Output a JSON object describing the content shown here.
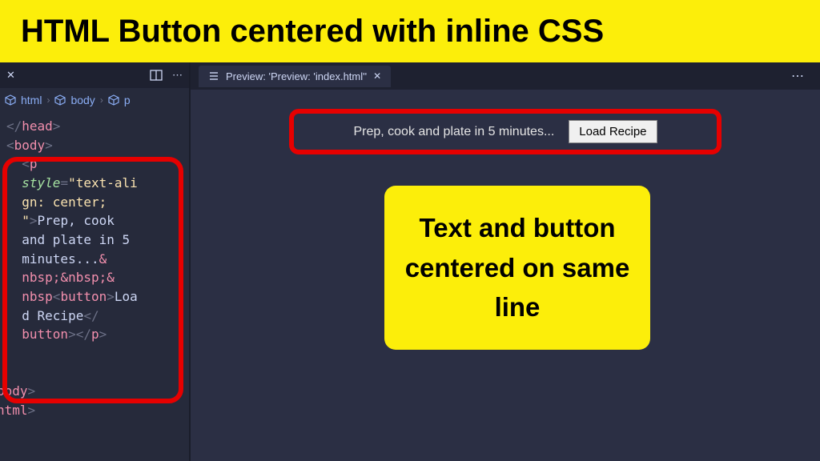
{
  "title": "HTML Button centered with inline CSS",
  "editor": {
    "breadcrumb": [
      "html",
      "body",
      "p"
    ],
    "code": {
      "line1_close_head": "head",
      "line2_open_body": "body",
      "p_tag": "p",
      "style_attr": "style",
      "style_val_part1": "\"text-ali",
      "style_val_part2": "gn: center;",
      "style_val_part3": "\"",
      "text_part1": "Prep, cook",
      "text_part2": "and plate in 5",
      "text_part3": "minutes...",
      "amp": "&",
      "nbsp1": "nbsp;",
      "nbsp2": "&nbsp;",
      "nbsp3": "nbsp",
      "button_tag": "button",
      "btn_text1": "Loa",
      "btn_text2": "d Recipe",
      "body_close": "body",
      "html_close": "html"
    }
  },
  "preview": {
    "tab_label": "Preview: 'Preview: 'index.html''",
    "text": "Prep, cook and plate in 5 minutes...",
    "button_label": "Load Recipe"
  },
  "callout": "Text and button centered on same line"
}
